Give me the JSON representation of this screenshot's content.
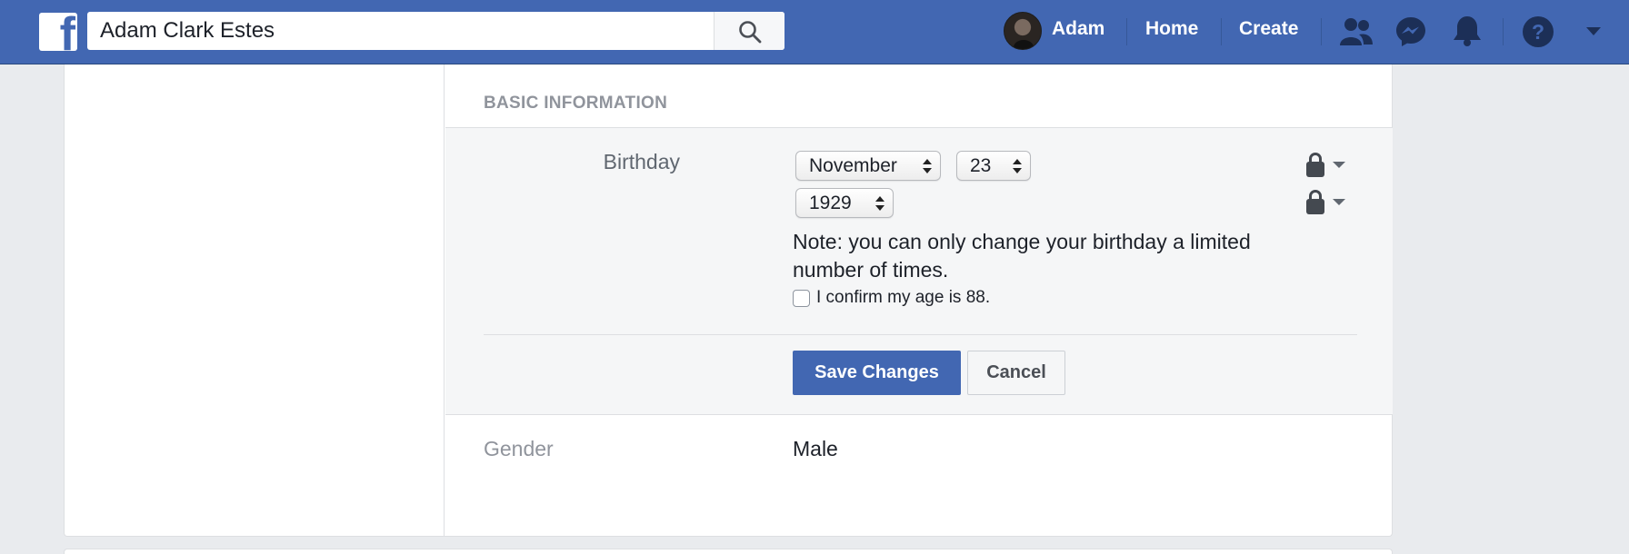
{
  "topbar": {
    "logo_letter": "f",
    "search_value": "Adam Clark Estes",
    "user_name": "Adam",
    "home_label": "Home",
    "create_label": "Create"
  },
  "icons": {
    "search": "search-icon",
    "friends": "friend-requests-icon",
    "messenger": "messenger-icon",
    "notifications": "bell-icon",
    "help": "help-icon",
    "menu": "caret-down-icon",
    "privacy": "lock-icon"
  },
  "colors": {
    "brand": "#4267b2",
    "panel": "#f5f6f7"
  },
  "basic_info": {
    "section_title": "BASIC INFORMATION",
    "birthday_label": "Birthday",
    "month": "November",
    "day": "23",
    "year": "1929",
    "note": "Note: you can only change your birthday a limited number of times.",
    "confirm_label": "I confirm my age is 88.",
    "confirm_checked": false,
    "save_label": "Save Changes",
    "cancel_label": "Cancel",
    "gender_label": "Gender",
    "gender_value": "Male"
  }
}
